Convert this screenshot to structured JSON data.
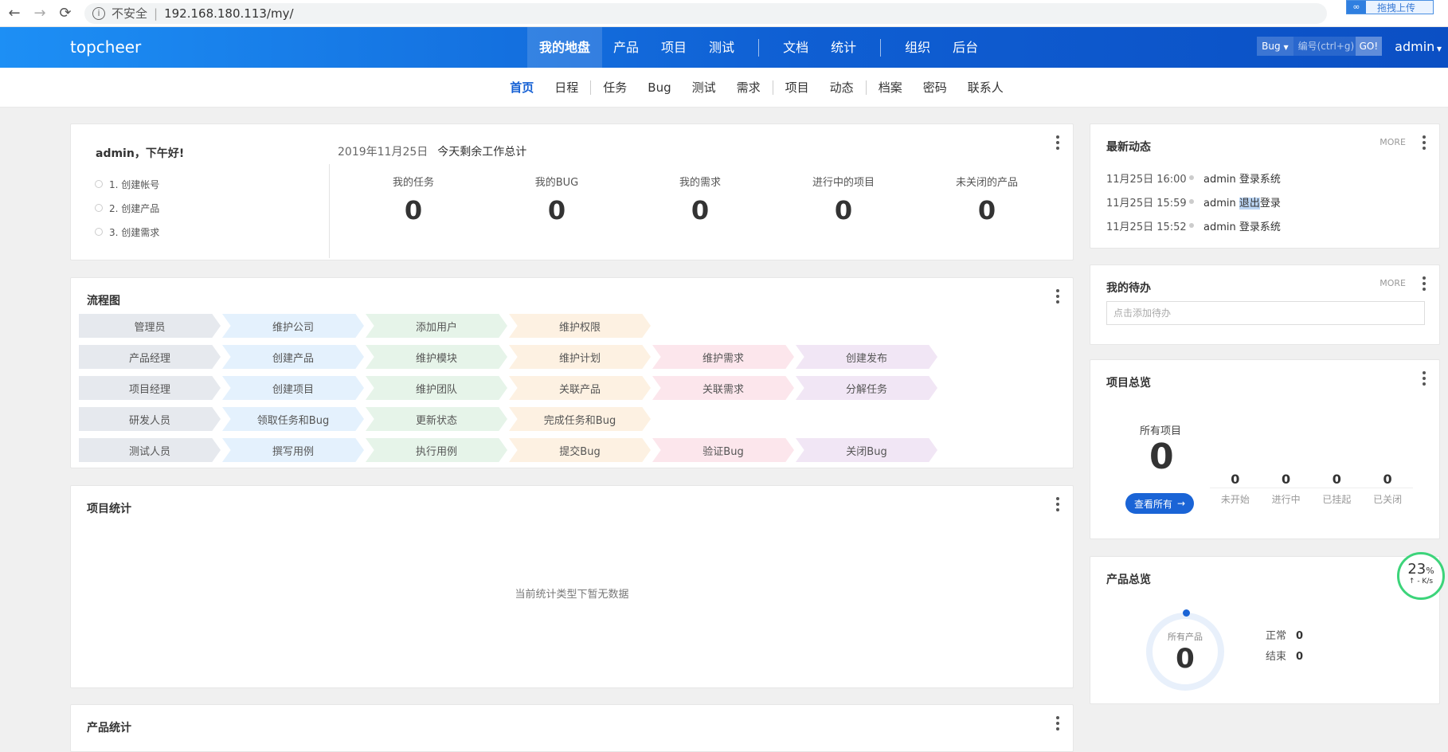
{
  "browser": {
    "security": "不安全",
    "url": "192.168.180.113/my/",
    "upload_label": "拖拽上传"
  },
  "header": {
    "logo": "topcheer",
    "nav": [
      "我的地盘",
      "产品",
      "项目",
      "测试",
      "文档",
      "统计",
      "组织",
      "后台"
    ],
    "search_type": "Bug",
    "search_placeholder": "编号(ctrl+g)",
    "go": "GO!",
    "user": "admin"
  },
  "subnav": [
    "首页",
    "日程",
    "任务",
    "Bug",
    "测试",
    "需求",
    "项目",
    "动态",
    "档案",
    "密码",
    "联系人"
  ],
  "welcome": {
    "greeting": "admin，下午好!",
    "steps": [
      "1. 创建帐号",
      "2. 创建产品",
      "3. 创建需求"
    ],
    "date": "2019年11月25日",
    "summary": "今天剩余工作总计",
    "stats": [
      {
        "label": "我的任务",
        "value": "0"
      },
      {
        "label": "我的BUG",
        "value": "0"
      },
      {
        "label": "我的需求",
        "value": "0"
      },
      {
        "label": "进行中的项目",
        "value": "0"
      },
      {
        "label": "未关闭的产品",
        "value": "0"
      }
    ]
  },
  "flow": {
    "title": "流程图",
    "rows": [
      [
        "管理员",
        "维护公司",
        "添加用户",
        "维护权限"
      ],
      [
        "产品经理",
        "创建产品",
        "维护模块",
        "维护计划",
        "维护需求",
        "创建发布"
      ],
      [
        "项目经理",
        "创建项目",
        "维护团队",
        "关联产品",
        "关联需求",
        "分解任务"
      ],
      [
        "研发人员",
        "领取任务和Bug",
        "更新状态",
        "完成任务和Bug"
      ],
      [
        "测试人员",
        "撰写用例",
        "执行用例",
        "提交Bug",
        "验证Bug",
        "关闭Bug"
      ]
    ]
  },
  "project_stats": {
    "title": "项目统计",
    "empty": "当前统计类型下暂无数据"
  },
  "product_stats": {
    "title": "产品统计"
  },
  "dynamics": {
    "title": "最新动态",
    "more": "MORE",
    "items": [
      {
        "time": "11月25日 16:00",
        "user": "admin",
        "action": "登录系统"
      },
      {
        "time": "11月25日 15:59",
        "user": "admin",
        "action_hl": "退出",
        "action": "登录"
      },
      {
        "time": "11月25日 15:52",
        "user": "admin",
        "action": "登录系统"
      }
    ]
  },
  "todo": {
    "title": "我的待办",
    "more": "MORE",
    "placeholder": "点击添加待办"
  },
  "project_overview": {
    "title": "项目总览",
    "all_label": "所有项目",
    "all_value": "0",
    "button": "查看所有",
    "stats": [
      {
        "label": "未开始",
        "value": "0"
      },
      {
        "label": "进行中",
        "value": "0"
      },
      {
        "label": "已挂起",
        "value": "0"
      },
      {
        "label": "已关闭",
        "value": "0"
      }
    ]
  },
  "product_overview": {
    "title": "产品总览",
    "all_label": "所有产品",
    "all_value": "0",
    "normal_label": "正常",
    "normal_value": "0",
    "closed_label": "结束",
    "closed_value": "0"
  },
  "speed": {
    "percent": "23",
    "unit": "%",
    "rate": "↑ - K/s"
  }
}
